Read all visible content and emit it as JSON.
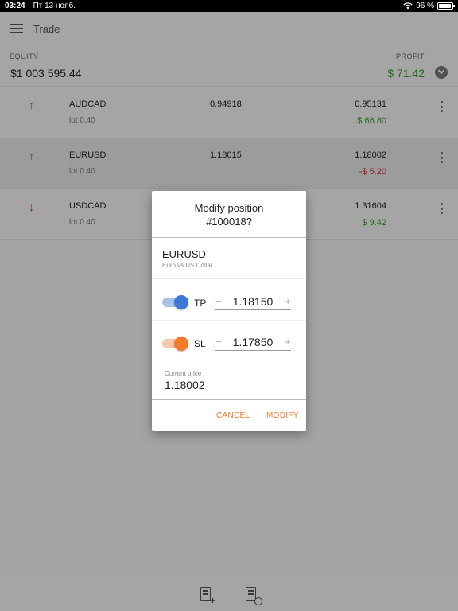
{
  "status_bar": {
    "time": "03:24",
    "date": "Пт 13 нояб.",
    "battery": "96 %"
  },
  "app_bar": {
    "title": "Trade"
  },
  "equity": {
    "equity_label": "EQUITY",
    "equity_currency": "$",
    "equity_value": "1 003 595.44",
    "profit_label": "PROFIT",
    "profit_value": "$ 71.42"
  },
  "positions": [
    {
      "direction": "up",
      "arrow": "↑",
      "symbol": "AUDCAD",
      "lot": "lot 0.40",
      "open_price": "0.94918",
      "current_price": "0.95131",
      "pl": "$ 66.80",
      "pl_sign": "positive"
    },
    {
      "direction": "up",
      "arrow": "↑",
      "symbol": "EURUSD",
      "lot": "lot 0.40",
      "open_price": "1.18015",
      "current_price": "1.18002",
      "pl": "-$ 5.20",
      "pl_sign": "negative"
    },
    {
      "direction": "down",
      "arrow": "↓",
      "symbol": "USDCAD",
      "lot": "lot 0.40",
      "open_price": "",
      "current_price": "1.31604",
      "pl": "$ 9.42",
      "pl_sign": "positive"
    }
  ],
  "dialog": {
    "title_line1": "Modify position",
    "title_line2": "#100018?",
    "symbol": "EURUSD",
    "description": "Euro vs US Dollar",
    "tp": {
      "label": "TP",
      "value": "1.18150",
      "minus": "−",
      "plus": "+",
      "enabled": true
    },
    "sl": {
      "label": "SL",
      "value": "1.17850",
      "minus": "−",
      "plus": "+",
      "enabled": true
    },
    "current_price_label": "Current price",
    "current_price": "1.18002",
    "cancel_label": "CANCEL",
    "modify_label": "MODIFY"
  },
  "bottom_bar": {
    "icons": [
      "new-order-icon",
      "pending-orders-icon"
    ]
  },
  "colors": {
    "profit_green": "#3a9d2f",
    "loss_red": "#d0312d",
    "accent_orange": "#f07a2b",
    "tp_blue": "#3e78d6",
    "sl_orange": "#f47b2b"
  }
}
